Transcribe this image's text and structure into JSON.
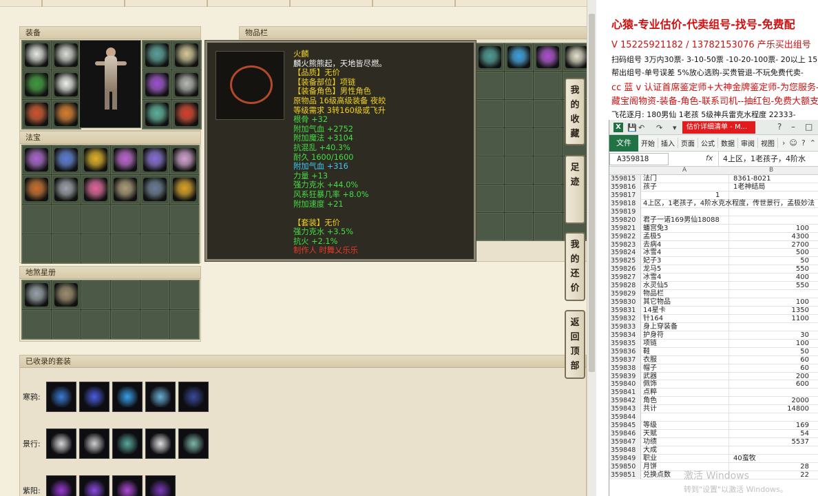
{
  "game": {
    "equip_title": "装备",
    "fabao_title": "法宝",
    "dishastar_title": "地煞星册",
    "bag_title": "物品栏",
    "suits_title": "已收录的套装",
    "side_buttons": [
      {
        "chars": [
          "我",
          "的",
          "收",
          "藏"
        ]
      },
      {
        "chars": [
          "足",
          "迹"
        ]
      },
      {
        "chars": [
          "我",
          "的",
          "还",
          "价"
        ]
      },
      {
        "chars": [
          "返",
          "回",
          "顶",
          "部"
        ]
      }
    ],
    "suits": [
      {
        "label": "寒鸦:",
        "colors": [
          "#3a7bd5",
          "#4a5fe0",
          "#3aa0e8",
          "#6ab0d8",
          "#3a4a9a"
        ]
      },
      {
        "label": "景行:",
        "colors": [
          "#d8d8d8",
          "#cfcfcf",
          "#5aa89a",
          "#e0e0e0",
          "#7fb8a8"
        ]
      },
      {
        "label": "紫阳:",
        "colors": [
          "#9a3ad5",
          "#8a4ae0",
          "#b04ad8",
          "#7a3ab8"
        ]
      }
    ],
    "equip_colors": [
      "#e8e8e8",
      "#dcdcdc",
      "#58a0a0",
      "#d8c89a",
      "#3a9a3a",
      "#f0f0f0",
      "#a04ad8",
      "#b8b8b8",
      "#d8502a",
      "#e07a2a",
      "#5ab0a0",
      "#e03a2a"
    ],
    "fabao_colors": [
      "#b060d8",
      "#5a7ae0",
      "#e8b020",
      "#c060d8",
      "#8a6ae0",
      "#d8a0d8",
      "#d06a2a",
      "#a0a0b0",
      "#e860a0",
      "#b09a7a",
      "#6a7a9a",
      "#e0a020"
    ],
    "bag_row_colors": [
      "#4a9a9a",
      "#3aa0e8",
      "#b04ad8",
      "#e8e0d0"
    ]
  },
  "tooltip": {
    "lines": [
      {
        "text": "火麟",
        "color": "#f0d020"
      },
      {
        "text": "麟火熊熊起，天地皆尽燃。",
        "color": "#f2f2f2"
      },
      {
        "text": "【品质】无价",
        "color": "#f0d020"
      },
      {
        "text": "【装备部位】项链",
        "color": "#f0d020"
      },
      {
        "text": "【装备角色】男性角色",
        "color": "#f0d020"
      },
      {
        "text": "原物品 16级高级装备 夜皎",
        "color": "#f0d020"
      },
      {
        "text": "等级需求 3转160级或飞升",
        "color": "#f0d020"
      },
      {
        "text": "根骨 +32",
        "color": "#44dd44"
      },
      {
        "text": "附加气血 +2752",
        "color": "#44dd44"
      },
      {
        "text": "附加魔法 +3104",
        "color": "#44dd44"
      },
      {
        "text": "抗混乱 +40.3%",
        "color": "#44dd44"
      },
      {
        "text": "耐久 1600/1600",
        "color": "#44dd44"
      },
      {
        "text": "附加气血 +316",
        "color": "#3ec8ee"
      },
      {
        "text": "力量 +13",
        "color": "#44dd44"
      },
      {
        "text": "强力克水 +44.0%",
        "color": "#44dd44"
      },
      {
        "text": "风系狂暴几率 +8.0%",
        "color": "#44dd44"
      },
      {
        "text": "附加速度 +21",
        "color": "#44dd44"
      },
      {
        "text": "",
        "color": "#44dd44"
      },
      {
        "text": "【套装】无价",
        "color": "#f0d020"
      },
      {
        "text": "强力克水 +3.5%",
        "color": "#44dd44"
      },
      {
        "text": "抗火 +2.1%",
        "color": "#44dd44"
      },
      {
        "text": "制作人 时舞乂乐乐",
        "color": "#e83a2a"
      }
    ]
  },
  "promo": {
    "headline": "心猿-专业估价-代卖组号-找号-免费配",
    "line2": "V 15225921182 / 13782153076 产乐买出组号",
    "line3": "扫码组号 3万内30票- 3-10-50票 -10-20-100票- 20以上 15",
    "line4": "帮出组号-单号误差 5%放心选购-买贵管退-不玩免费代卖-",
    "line5": "cc 蓝 v 认证首席鉴定师+大神金牌鉴定师-为您服务-",
    "line6": "藏宝阁物资-装备-角色-联系司机--抽红包-免费大额支",
    "line7": "飞花逐月: 180男仙 1老孩 5级神兵雷克水程度 22333-"
  },
  "excel": {
    "doc_title": "估价详细清单 - M...",
    "file_tab": "文件",
    "tabs": [
      "开始",
      "插入",
      "页面",
      "公式",
      "数据",
      "审阅",
      "视图"
    ],
    "name_box": "A359818",
    "fx": "fx",
    "formula_value": "4上区，1老孩子，4阶水",
    "col_a": "A",
    "col_b": "B",
    "rows": [
      {
        "n": "359815",
        "a": "法门",
        "b": "8361-8021",
        "bl": true
      },
      {
        "n": "359816",
        "a": "孩子",
        "b": "1老神结局",
        "bl": true
      },
      {
        "n": "359817",
        "a": "",
        "b": "1",
        "bl": false,
        "bc": true
      },
      {
        "n": "359818",
        "a": "4上区，1老孩子，4阶水克水程度，传世景行，孟极妙法",
        "b": "",
        "bl": false
      },
      {
        "n": "359819",
        "a": "",
        "b": "",
        "bl": false
      },
      {
        "n": "359820",
        "a": "君子一诺169男仙18088",
        "b": "",
        "bl": false
      },
      {
        "n": "359821",
        "a": "蟠宫兔3",
        "b": "100",
        "bl": false
      },
      {
        "n": "359822",
        "a": "孟极5",
        "b": "4300",
        "bl": false
      },
      {
        "n": "359823",
        "a": "去病4",
        "b": "2700",
        "bl": false
      },
      {
        "n": "359824",
        "a": "冰雪4",
        "b": "500",
        "bl": false
      },
      {
        "n": "359825",
        "a": "妃子3",
        "b": "50",
        "bl": false
      },
      {
        "n": "359826",
        "a": "龙马5",
        "b": "550",
        "bl": false
      },
      {
        "n": "359827",
        "a": "冰雪4",
        "b": "400",
        "bl": false
      },
      {
        "n": "359828",
        "a": "水灵仙5",
        "b": "550",
        "bl": false
      },
      {
        "n": "359829",
        "a": "物品栏",
        "b": "",
        "bl": false
      },
      {
        "n": "359830",
        "a": "其它物品",
        "b": "100",
        "bl": false
      },
      {
        "n": "359831",
        "a": "14星卡",
        "b": "1350",
        "bl": false
      },
      {
        "n": "359832",
        "a": "针164",
        "b": "1100",
        "bl": false
      },
      {
        "n": "359833",
        "a": "身上穿装备",
        "b": "",
        "bl": false
      },
      {
        "n": "359834",
        "a": "护身符",
        "b": "30",
        "bl": false
      },
      {
        "n": "359835",
        "a": "项链",
        "b": "100",
        "bl": false
      },
      {
        "n": "359836",
        "a": "鞋",
        "b": "50",
        "bl": false
      },
      {
        "n": "359837",
        "a": "衣服",
        "b": "60",
        "bl": false
      },
      {
        "n": "359838",
        "a": "帽子",
        "b": "60",
        "bl": false
      },
      {
        "n": "359839",
        "a": "武器",
        "b": "200",
        "bl": false
      },
      {
        "n": "359840",
        "a": "佩饰",
        "b": "600",
        "bl": false
      },
      {
        "n": "359841",
        "a": "点粹",
        "b": "",
        "bl": false
      },
      {
        "n": "359842",
        "a": "角色",
        "b": "2000",
        "bl": false
      },
      {
        "n": "359843",
        "a": "共计",
        "b": "14800",
        "bl": false
      },
      {
        "n": "359844",
        "a": "",
        "b": "",
        "bl": false
      },
      {
        "n": "359845",
        "a": "等级",
        "b": "169",
        "bl": false
      },
      {
        "n": "359846",
        "a": "天赋",
        "b": "54",
        "bl": false
      },
      {
        "n": "359847",
        "a": "功绩",
        "b": "5537",
        "bl": false
      },
      {
        "n": "359848",
        "a": "大成",
        "b": "",
        "bl": false
      },
      {
        "n": "359849",
        "a": "职业",
        "b": "40蛮牧",
        "bl": true
      },
      {
        "n": "359850",
        "a": "月饼",
        "b": "28",
        "bl": false
      },
      {
        "n": "359851",
        "a": "兑换点数",
        "b": "22",
        "bl": false
      }
    ],
    "watermark_1": "激活 Windows",
    "watermark_2": "转到\"设置\"以激活 Windows。"
  }
}
